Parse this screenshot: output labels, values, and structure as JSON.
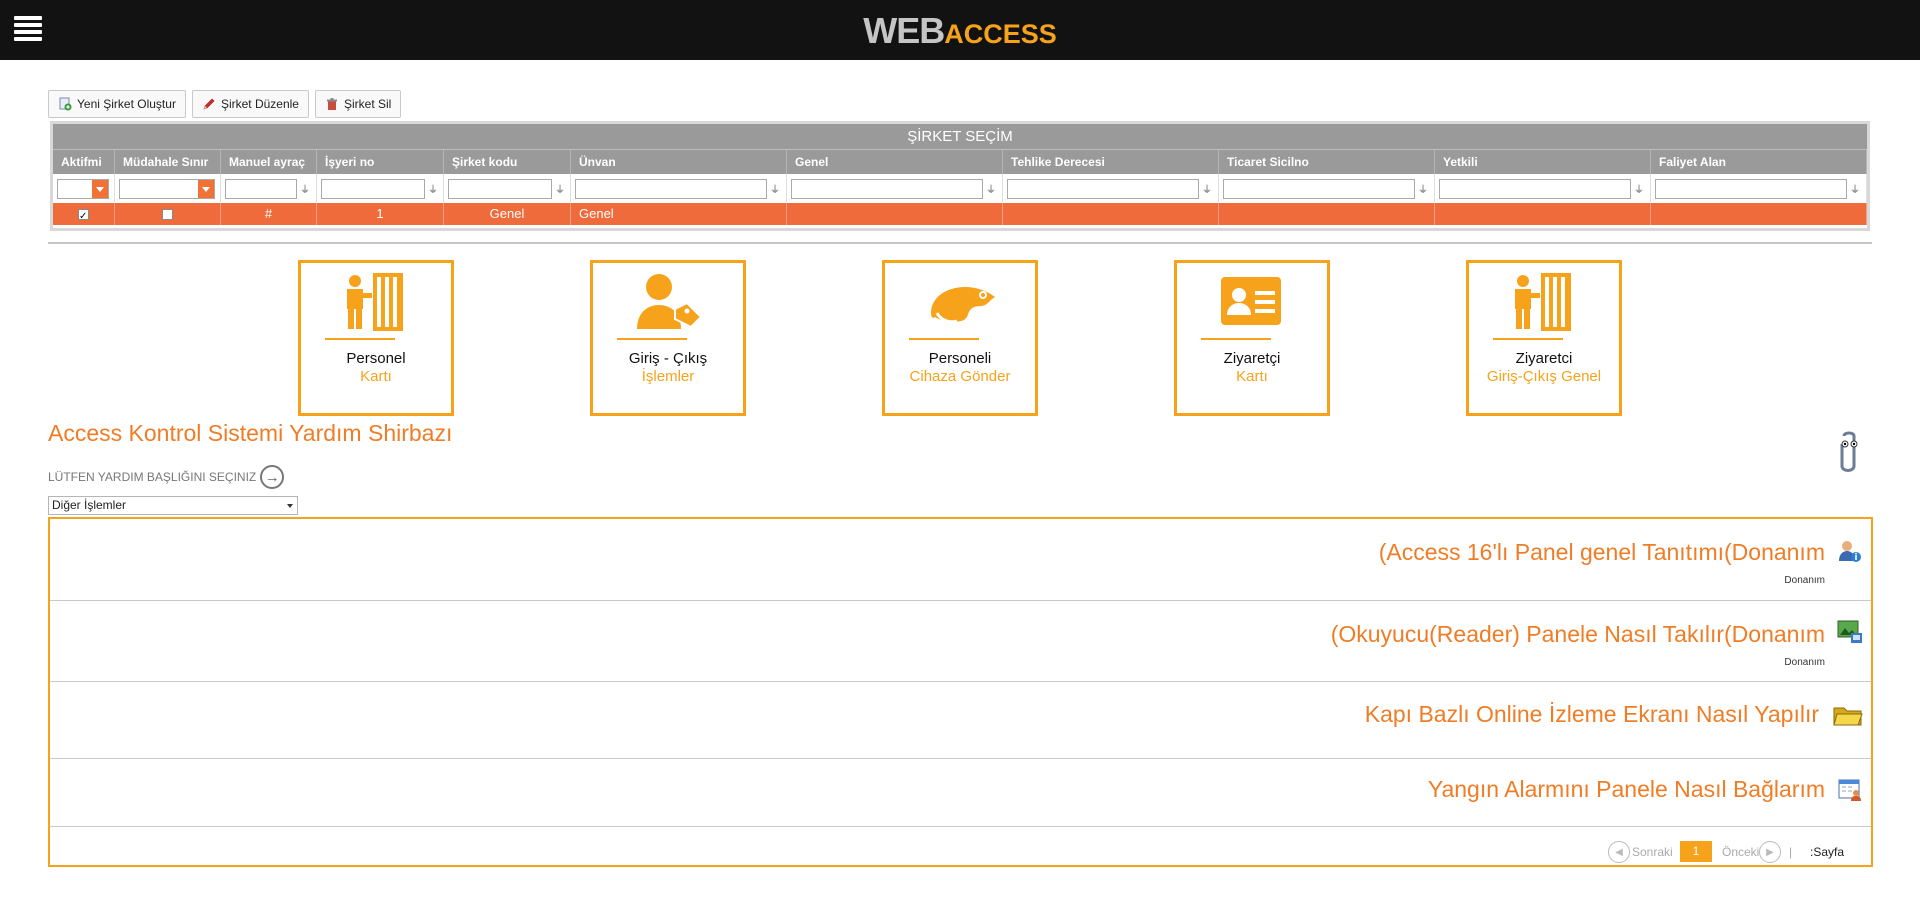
{
  "header": {
    "logo_web": "WEB",
    "logo_access": "ACCESS",
    "menu_icon": "hamburger-icon"
  },
  "toolbar": {
    "new_company": "Yeni Şirket Oluştur",
    "edit_company": "Şirket Düzenle",
    "delete_company": "Şirket Sil"
  },
  "grid": {
    "title": "ŞİRKET SEÇİM",
    "columns": [
      "Aktifmi",
      "Müdahale Sınır",
      "Manuel ayraç",
      "İşyeri no",
      "Şirket kodu",
      "Ünvan",
      "Genel",
      "Tehlike Derecesi",
      "Ticaret Sicilno",
      "Yetkili",
      "Faliyet Alan"
    ],
    "row": {
      "aktif": true,
      "mudahale": false,
      "manuel": "#",
      "isyeri": "1",
      "kod": "Genel",
      "unvan": "Genel"
    },
    "active_color": "#f06b3b"
  },
  "tiles": [
    {
      "line1": "Personel",
      "line2": "Kartı",
      "icon": "door-person-icon"
    },
    {
      "line1": "Giriş - Çıkış",
      "line2": "İşlemler",
      "icon": "person-tag-icon"
    },
    {
      "line1": "Personeli",
      "line2": "Cihaza Gönder",
      "icon": "chameleon-icon"
    },
    {
      "line1": "Ziyaretçi",
      "line2": "Kartı",
      "icon": "id-card-icon"
    },
    {
      "line1": "Ziyaretci",
      "line2": "Giriş-Çıkış Genel",
      "icon": "door-person-icon"
    }
  ],
  "help": {
    "title": "Access Kontrol Sistemi Yardım Shirbazı",
    "subtitle": "LÜTFEN YARDIM BAŞLIĞINI SEÇINIZ",
    "selected": "Diğer İşlemler",
    "items": [
      {
        "title": "(Access 16'lı Panel genel Tanıtımı(Donanım",
        "category": "Donanım",
        "icon": "user-info-icon"
      },
      {
        "title": "(Okuyucu(Reader) Panele Nasıl Takılır(Donanım",
        "category": "Donanım",
        "icon": "network-image-icon"
      },
      {
        "title": "Kapı Bazlı Online İzleme Ekranı Nasıl Yapılır",
        "category": "",
        "icon": "folder-open-icon"
      },
      {
        "title": "Yangın Alarmını Panele Nasıl Bağlarım",
        "category": "",
        "icon": "calendar-user-icon"
      }
    ],
    "pager": {
      "next": "Sonraki",
      "prev": "Önceki",
      "page": "1",
      "label": ":Sayfa",
      "separator": "|"
    }
  },
  "colors": {
    "accent": "#f7a21b",
    "accent_text": "#f07d26",
    "header_bg": "#121212"
  }
}
